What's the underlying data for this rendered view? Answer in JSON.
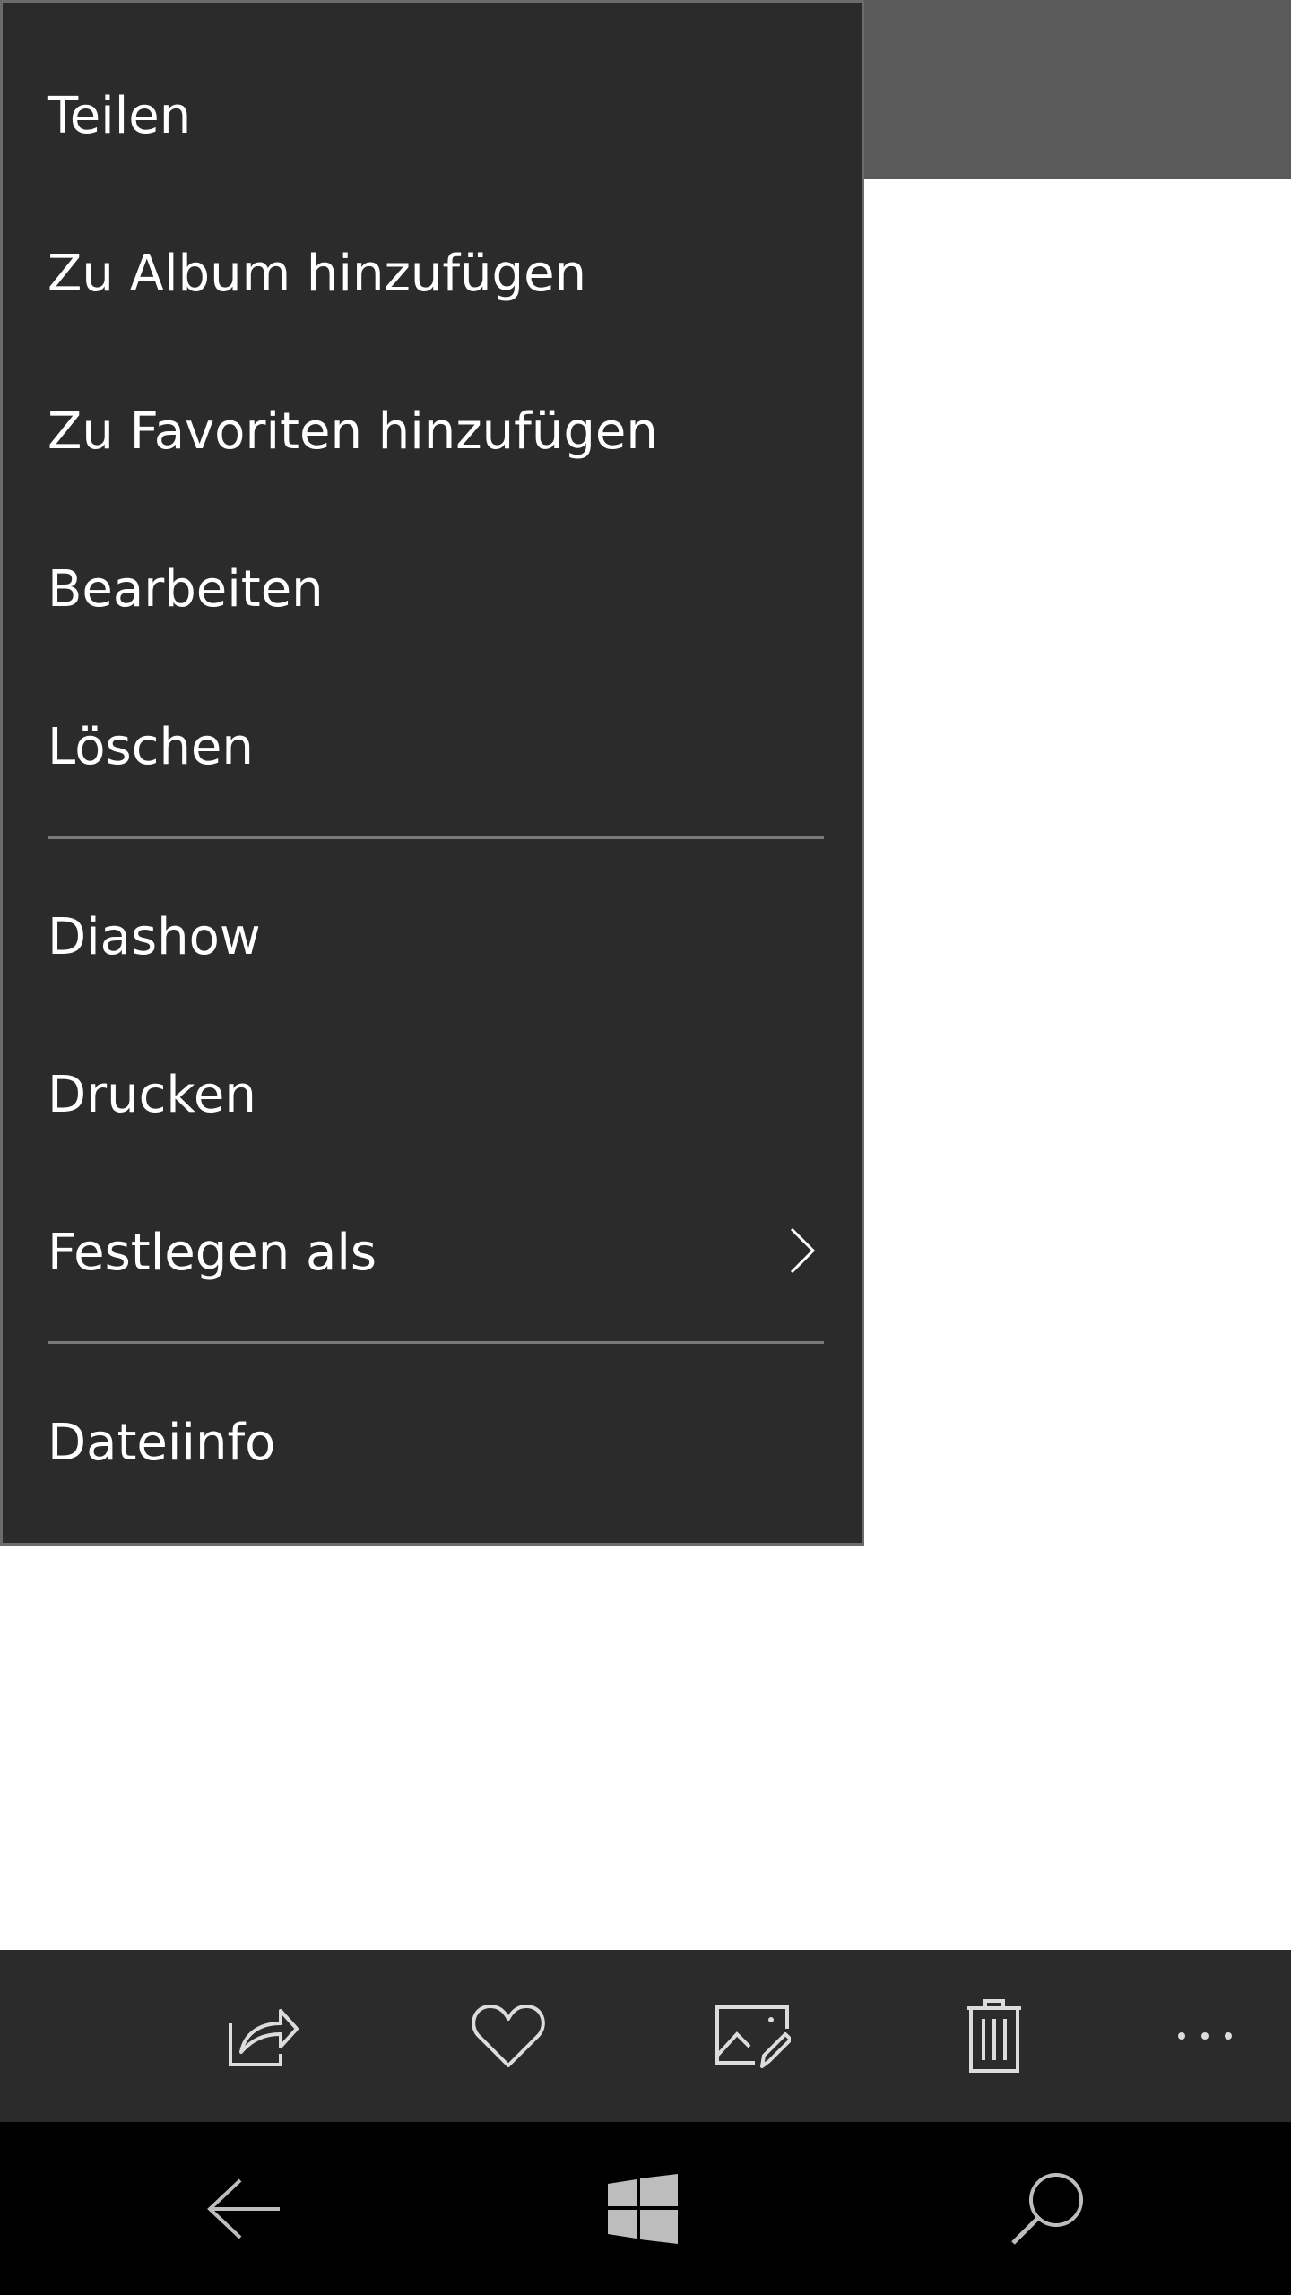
{
  "context_menu": {
    "items": [
      {
        "label": "Teilen"
      },
      {
        "label": "Zu Album hinzufügen"
      },
      {
        "label": "Zu Favoriten hinzufügen"
      },
      {
        "label": "Bearbeiten"
      },
      {
        "label": "Löschen"
      },
      {
        "label": "Diashow"
      },
      {
        "label": "Drucken"
      },
      {
        "label": "Festlegen als",
        "has_submenu": true
      },
      {
        "label": "Dateiinfo"
      }
    ]
  },
  "app_bar": {
    "buttons": [
      {
        "icon": "share-icon"
      },
      {
        "icon": "heart-icon"
      },
      {
        "icon": "edit-image-icon"
      },
      {
        "icon": "trash-icon"
      },
      {
        "icon": "more-icon"
      }
    ]
  },
  "nav_bar": {
    "buttons": [
      {
        "icon": "back-arrow-icon"
      },
      {
        "icon": "windows-logo-icon"
      },
      {
        "icon": "search-icon"
      }
    ]
  },
  "colors": {
    "menu_background": "#2b2b2b",
    "menu_border": "#6b6b6b",
    "top_bar": "#5a5a5a",
    "app_bar": "#2b2b2b",
    "nav_bar": "#000000",
    "text": "#ffffff",
    "icon": "#cfcfcf"
  }
}
